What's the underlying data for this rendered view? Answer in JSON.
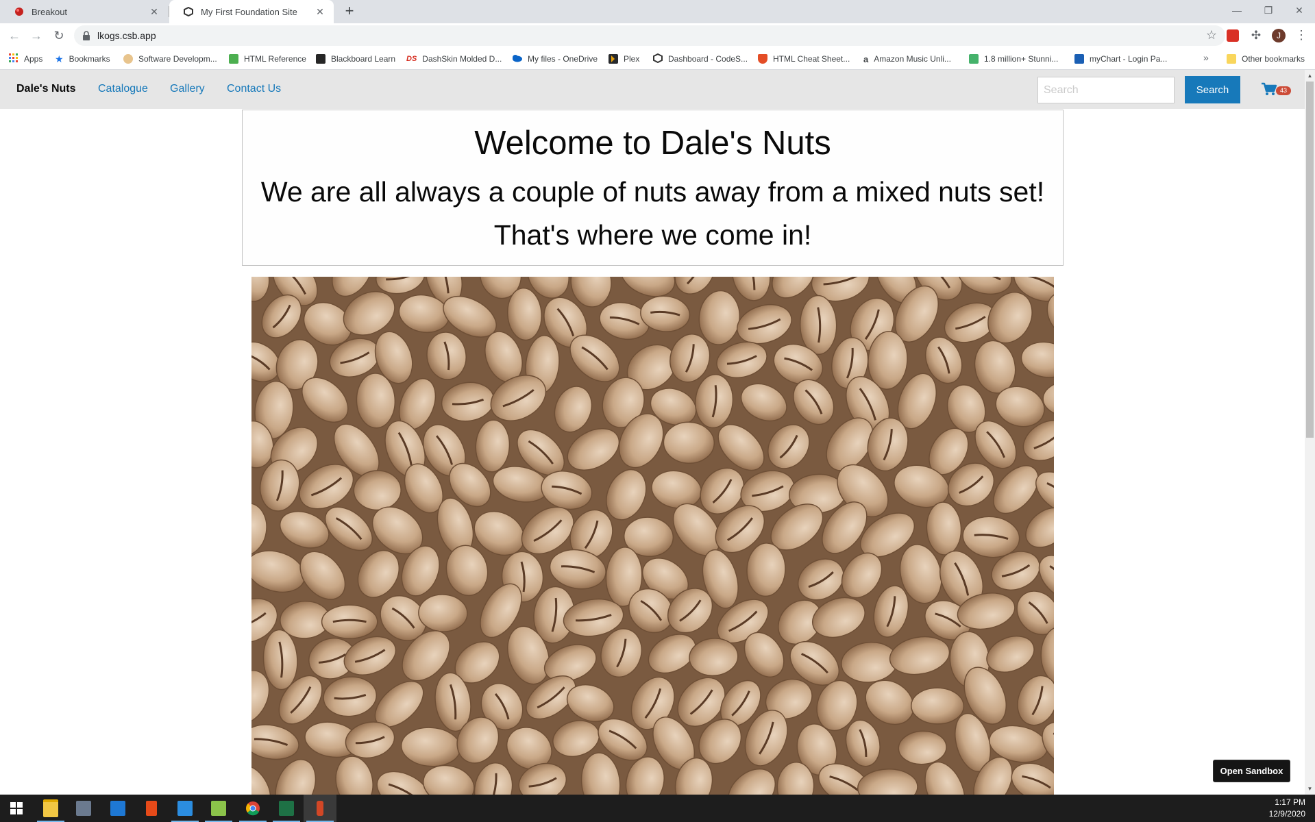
{
  "browser": {
    "tabs": [
      {
        "title": "Breakout",
        "active": false
      },
      {
        "title": "My First Foundation Site",
        "active": true
      }
    ],
    "url": "lkogs.csb.app",
    "profile_initial": "J",
    "bookmarks": [
      {
        "label": "Apps",
        "icon": "apps-grid-icon",
        "color": "#ea4335"
      },
      {
        "label": "Bookmarks",
        "icon": "star-icon",
        "color": "#1a73e8"
      },
      {
        "label": "Software Developm...",
        "icon": "gear-icon",
        "color": "#e8a33d"
      },
      {
        "label": "HTML Reference",
        "icon": "w3-icon",
        "color": "#4caf50"
      },
      {
        "label": "Blackboard Learn",
        "icon": "bb-icon",
        "color": "#262626"
      },
      {
        "label": "DashSkin Molded D...",
        "icon": "ds-icon",
        "color": "#d62d20"
      },
      {
        "label": "My files - OneDrive",
        "icon": "cloud-icon",
        "color": "#0a64c8"
      },
      {
        "label": "Plex",
        "icon": "plex-icon",
        "color": "#e5a00d"
      },
      {
        "label": "Dashboard - CodeS...",
        "icon": "codesandbox-icon",
        "color": "#333333"
      },
      {
        "label": "HTML Cheat Sheet...",
        "icon": "shield-icon",
        "color": "#e44d26"
      },
      {
        "label": "Amazon Music Unli...",
        "icon": "amazon-icon",
        "color": "#111111"
      },
      {
        "label": "1.8 million+ Stunni...",
        "icon": "px-icon",
        "color": "#45b26b"
      },
      {
        "label": "myChart - Login Pa...",
        "icon": "mychart-icon",
        "color": "#1a5fb4"
      }
    ],
    "other_bookmarks": "Other bookmarks"
  },
  "site": {
    "brand": "Dale's Nuts",
    "menu": [
      "Catalogue",
      "Gallery",
      "Contact Us"
    ],
    "search_placeholder": "Search",
    "search_button": "Search",
    "cart_count": "43",
    "welcome": {
      "title": "Welcome to Dale's Nuts",
      "line1": "We are all always a couple of nuts away from a mixed nuts set!",
      "line2": "That's where we come in!"
    },
    "hero_image": "pistachios-photo",
    "open_sandbox": "Open Sandbox"
  },
  "taskbar": {
    "apps": [
      "windows-start-icon",
      "file-explorer-icon",
      "calculator-icon",
      "mail-icon",
      "office-icon",
      "vscode-icon",
      "notepad-icon",
      "chrome-icon",
      "excel-icon",
      "snipping-tool-icon"
    ],
    "time": "1:17 PM",
    "date": "12/9/2020"
  },
  "colors": {
    "primary": "#1779ba",
    "topbar_bg": "#e6e6e6",
    "badge": "#cc4b37"
  }
}
